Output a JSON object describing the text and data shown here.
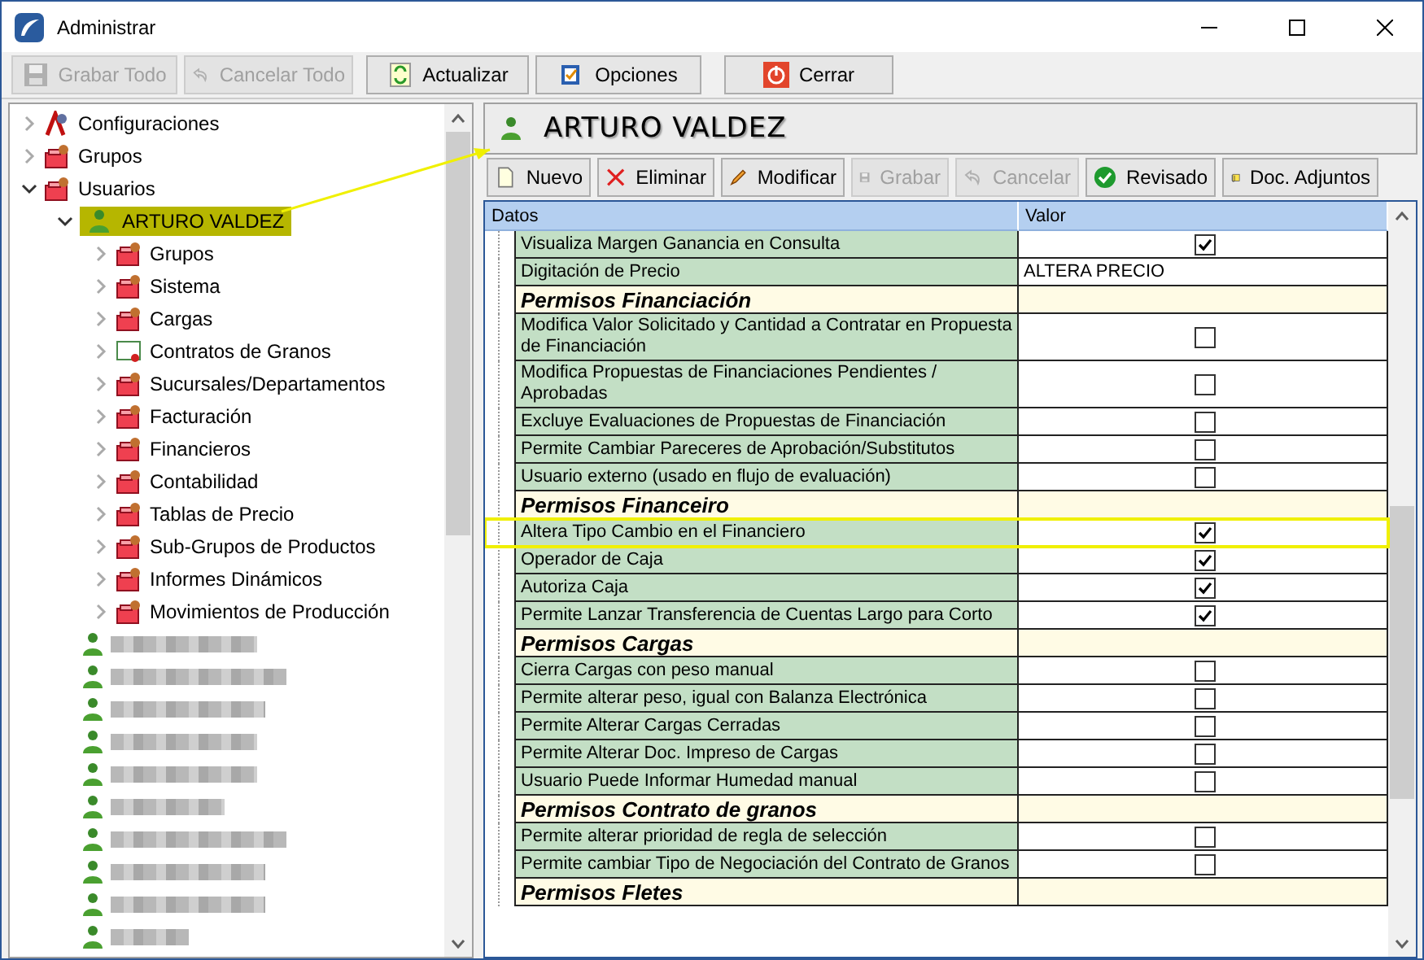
{
  "window": {
    "title": "Administrar"
  },
  "toolbar": [
    {
      "label": "Grabar Todo",
      "kind": "save",
      "disabled": true
    },
    {
      "label": "Cancelar Todo",
      "kind": "undo",
      "disabled": true
    },
    {
      "label": "Actualizar",
      "kind": "refresh",
      "disabled": false
    },
    {
      "label": "Opciones",
      "kind": "options",
      "disabled": false
    },
    {
      "label": "Cerrar",
      "kind": "close",
      "disabled": false
    }
  ],
  "tree": [
    {
      "label": "Configuraciones",
      "kind": "config",
      "expanded": false,
      "selected": false
    },
    {
      "label": "Grupos",
      "kind": "folder",
      "expanded": false,
      "selected": false
    },
    {
      "label": "Usuarios",
      "kind": "folder",
      "expanded": true,
      "selected": false,
      "children": [
        {
          "label": "ARTURO VALDEZ",
          "kind": "user",
          "expanded": true,
          "selected": true,
          "children": [
            {
              "label": "Grupos",
              "kind": "folder",
              "expanded": false,
              "selected": false
            },
            {
              "label": "Sistema",
              "kind": "folder",
              "expanded": false,
              "selected": false
            },
            {
              "label": "Cargas",
              "kind": "folder",
              "expanded": false,
              "selected": false
            },
            {
              "label": "Contratos de Granos",
              "kind": "certificate",
              "expanded": false,
              "selected": false
            },
            {
              "label": "Sucursales/Departamentos",
              "kind": "folder",
              "expanded": false,
              "selected": false
            },
            {
              "label": "Facturación",
              "kind": "folder",
              "expanded": false,
              "selected": false
            },
            {
              "label": "Financieros",
              "kind": "folder",
              "expanded": false,
              "selected": false
            },
            {
              "label": "Contabilidad",
              "kind": "folder",
              "expanded": false,
              "selected": false
            },
            {
              "label": "Tablas de Precio",
              "kind": "folder",
              "expanded": false,
              "selected": false
            },
            {
              "label": "Sub-Grupos de Productos",
              "kind": "folder",
              "expanded": false,
              "selected": false
            },
            {
              "label": "Informes Dinámicos",
              "kind": "folder",
              "expanded": false,
              "selected": false
            },
            {
              "label": "Movimientos de Producción",
              "kind": "folder",
              "expanded": false,
              "selected": false
            }
          ]
        },
        {
          "kind": "redacted"
        },
        {
          "kind": "redacted"
        },
        {
          "kind": "redacted"
        },
        {
          "kind": "redacted"
        },
        {
          "kind": "redacted"
        },
        {
          "kind": "redacted"
        },
        {
          "kind": "redacted"
        },
        {
          "kind": "redacted"
        },
        {
          "kind": "redacted"
        },
        {
          "kind": "redacted"
        }
      ]
    }
  ],
  "user_header": {
    "name": "ARTURO VALDEZ"
  },
  "actions": [
    {
      "label": "Nuevo",
      "kind": "new",
      "disabled": false
    },
    {
      "label": "Eliminar",
      "kind": "delete",
      "disabled": false
    },
    {
      "label": "Modificar",
      "kind": "edit",
      "disabled": false
    },
    {
      "label": "Grabar",
      "kind": "save",
      "disabled": true
    },
    {
      "label": "Cancelar",
      "kind": "undo",
      "disabled": true
    },
    {
      "label": "Revisado",
      "kind": "check",
      "disabled": false
    },
    {
      "label": "Doc. Adjuntos",
      "kind": "attach",
      "disabled": false
    }
  ],
  "grid": {
    "columns": [
      "Datos",
      "Valor"
    ],
    "rows": [
      {
        "kind": "check",
        "label": "Visualiza Margen Ganancia en Consulta",
        "checked": true,
        "highlighted": false
      },
      {
        "kind": "text",
        "label": "Digitación de Precio",
        "value": "ALTERA PRECIO",
        "highlighted": false
      },
      {
        "kind": "section",
        "label": "Permisos Financiación",
        "highlighted": false
      },
      {
        "kind": "check",
        "label": "Modifica Valor Solicitado y Cantidad a Contratar en Propuesta de Financiación",
        "checked": false,
        "highlighted": false
      },
      {
        "kind": "check",
        "label": "Modifica Propuestas de Financiaciones Pendientes / Aprobadas",
        "checked": false,
        "highlighted": false
      },
      {
        "kind": "check",
        "label": "Excluye Evaluaciones de Propuestas de Financiación",
        "checked": false,
        "highlighted": false
      },
      {
        "kind": "check",
        "label": "Permite Cambiar Pareceres de Aprobación/Substitutos",
        "checked": false,
        "highlighted": false
      },
      {
        "kind": "check",
        "label": "Usuario externo (usado en flujo de evaluación)",
        "checked": false,
        "highlighted": false
      },
      {
        "kind": "section",
        "label": "Permisos Financeiro",
        "highlighted": false
      },
      {
        "kind": "check",
        "label": "Altera Tipo Cambio en el Financiero",
        "checked": true,
        "highlighted": true
      },
      {
        "kind": "check",
        "label": "Operador de Caja",
        "checked": true,
        "highlighted": false
      },
      {
        "kind": "check",
        "label": "Autoriza Caja",
        "checked": true,
        "highlighted": false
      },
      {
        "kind": "check",
        "label": "Permite Lanzar Transferencia de Cuentas Largo para Corto",
        "checked": true,
        "highlighted": false
      },
      {
        "kind": "section",
        "label": "Permisos Cargas",
        "highlighted": false
      },
      {
        "kind": "check",
        "label": "Cierra Cargas con peso manual",
        "checked": false,
        "highlighted": false
      },
      {
        "kind": "check",
        "label": "Permite alterar peso, igual con Balanza Electrónica",
        "checked": false,
        "highlighted": false
      },
      {
        "kind": "check",
        "label": "Permite Alterar Cargas Cerradas",
        "checked": false,
        "highlighted": false
      },
      {
        "kind": "check",
        "label": "Permite Alterar Doc. Impreso de Cargas",
        "checked": false,
        "highlighted": false
      },
      {
        "kind": "check",
        "label": "Usuario Puede Informar Humedad manual",
        "checked": false,
        "highlighted": false
      },
      {
        "kind": "section",
        "label": "Permisos Contrato de granos",
        "highlighted": false
      },
      {
        "kind": "check",
        "label": "Permite alterar prioridad de regla de selección",
        "checked": false,
        "highlighted": false
      },
      {
        "kind": "check",
        "label": "Permite cambiar Tipo de Negociación del Contrato de Granos",
        "checked": false,
        "highlighted": false
      },
      {
        "kind": "section",
        "label": "Permisos Fletes",
        "highlighted": false
      }
    ]
  }
}
